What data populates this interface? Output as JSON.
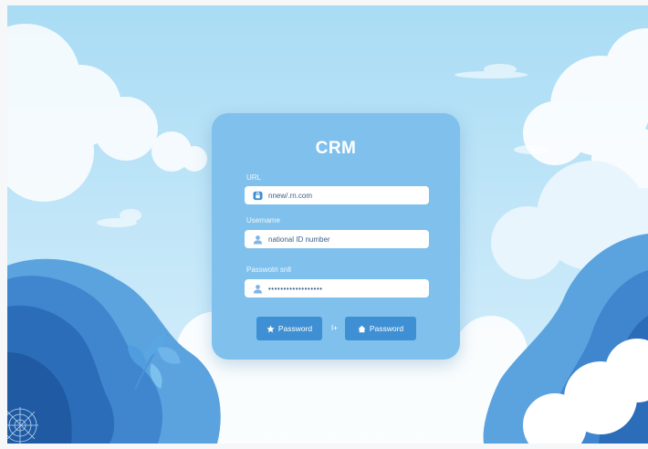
{
  "login": {
    "title": "CRM",
    "url_label": "URL",
    "url_value": "nnew/.rn.com",
    "username_label": "Username",
    "username_value": "national ID number",
    "password_label": "Passwotri snll",
    "password_value": "••••••••••••••••••",
    "separator": "I+",
    "button_left": "Password",
    "button_right": "Password"
  },
  "icons": {
    "url": "globe-icon",
    "username": "user-icon",
    "password": "user-icon",
    "button_left": "star-icon",
    "button_right": "home-icon"
  },
  "colors": {
    "card": "#7fc1ec",
    "button": "#3e8fd3",
    "sky": "#bfe5f8"
  }
}
